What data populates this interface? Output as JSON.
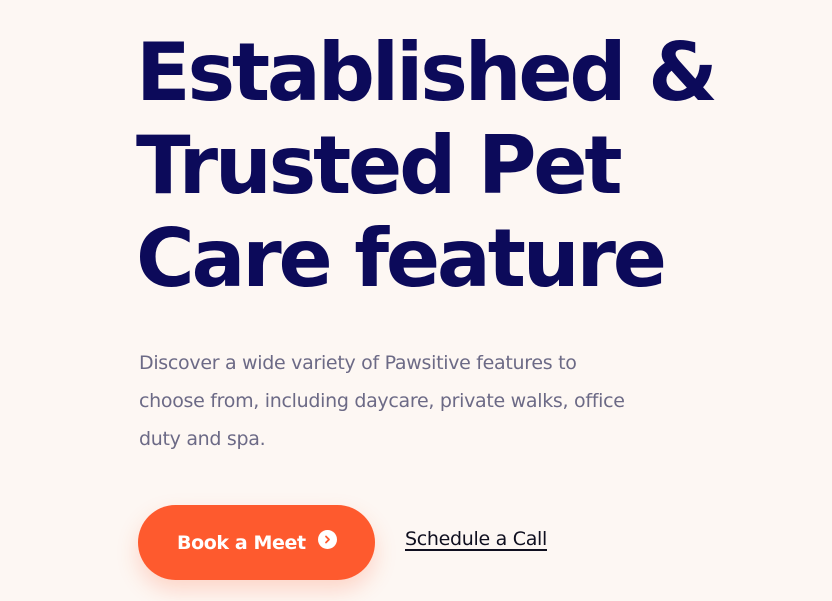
{
  "hero": {
    "title_lines": [
      "Established &",
      "Trusted Pet",
      "Care feature"
    ],
    "description": "Discover a wide variety of Pawsitive features to choose from, including daycare, private walks, office duty and spa."
  },
  "actions": {
    "primary_label": "Book a Meet",
    "primary_icon": "arrow-right-circle-icon",
    "secondary_label": "Schedule a Call"
  },
  "colors": {
    "background": "#fdf7f3",
    "title": "#0c0a5a",
    "description": "#6c6a86",
    "accent": "#fe5a2e",
    "link": "#0f0f1f"
  }
}
